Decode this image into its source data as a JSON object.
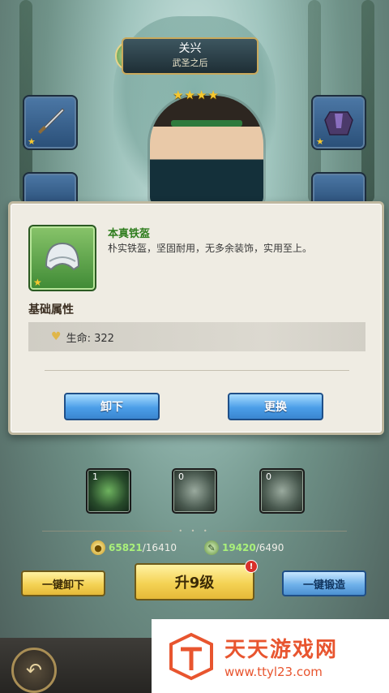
{
  "hero": {
    "name": "关兴",
    "subtitle": "武圣之后",
    "stars": 4
  },
  "icons": {
    "emblem": "leaf-emblem-icon",
    "weapon": "sword-icon",
    "armor": "armor-icon",
    "helmet": "helmet-icon",
    "back": "back-arrow-icon"
  },
  "dialog": {
    "item_name": "本真铁盔",
    "item_desc": "朴实铁盔，坚固耐用，无多余装饰，实用至上。",
    "attr_title": "基础属性",
    "attr_line": "生命: 322",
    "btn_unequip": "卸下",
    "btn_replace": "更换"
  },
  "skills": [
    {
      "level": "1"
    },
    {
      "level": "0"
    },
    {
      "level": "0"
    }
  ],
  "resources": {
    "coin_current": "65821",
    "coin_total": "/16410",
    "material_current": "19420",
    "material_total": "/6490"
  },
  "actions": {
    "unequip_all": "一键卸下",
    "upgrade": "升9级",
    "forge_all": "一键锻造",
    "badge": "!"
  },
  "watermark": {
    "title": "天天游戏网",
    "url": "www.ttyl23.com"
  },
  "colors": {
    "accent_green": "#2f7d1e",
    "button_blue": "#4b9ee8",
    "button_yellow": "#f4d254",
    "watermark_orange": "#e8552f"
  }
}
